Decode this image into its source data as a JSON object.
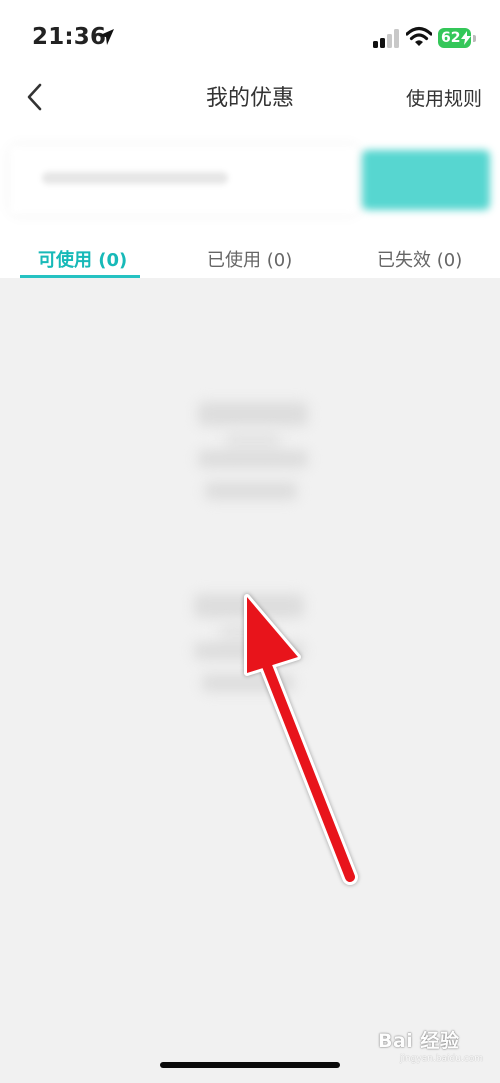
{
  "status_bar": {
    "time": "21:36",
    "battery_level": "62",
    "location_icon": "location-arrow-icon",
    "signal_icon": "cellular-signal-icon",
    "wifi_icon": "wifi-icon",
    "battery_icon": "battery-charging-icon"
  },
  "nav": {
    "back_icon": "chevron-left-icon",
    "title": "我的优惠",
    "rules_label": "使用规则"
  },
  "tabs": [
    {
      "label": "可使用 (0)",
      "active": true
    },
    {
      "label": "已使用 (0)",
      "active": false
    },
    {
      "label": "已失效 (0)",
      "active": false
    }
  ],
  "colors": {
    "accent": "#17b9b8",
    "underline": "#25c2c2",
    "redeem_button": "#57d6d0",
    "page_background": "#f1f1f1",
    "annotation_arrow": "#e8141b",
    "battery": "#34c759"
  },
  "watermark": {
    "text": "Bai 经验",
    "sub": "jingyan.baidu.com",
    "icon": "baidu-paw-icon"
  },
  "annotation": {
    "icon": "red-arrow-icon"
  }
}
